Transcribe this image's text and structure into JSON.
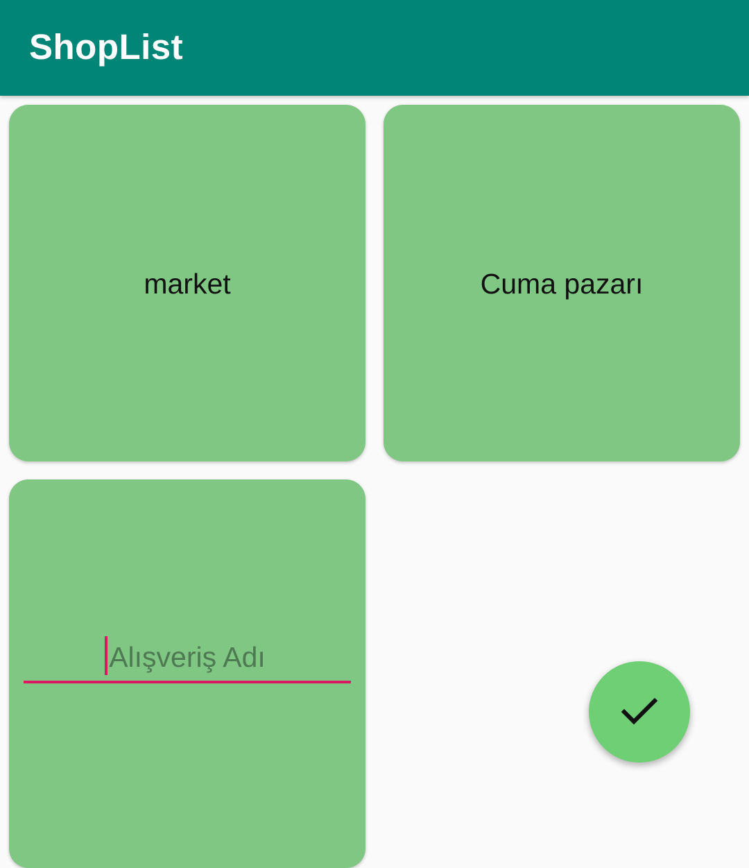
{
  "app_bar": {
    "title": "ShopList",
    "color": "#008577"
  },
  "cards": [
    {
      "label": "market",
      "color": "#81c784"
    },
    {
      "label": "Cuma pazarı",
      "color": "#81c784"
    }
  ],
  "new_card": {
    "input_value": "",
    "input_placeholder": "Alışveriş Adı",
    "accent_color": "#d81b60"
  },
  "fab": {
    "icon": "check-icon",
    "color": "#6fcf75"
  }
}
